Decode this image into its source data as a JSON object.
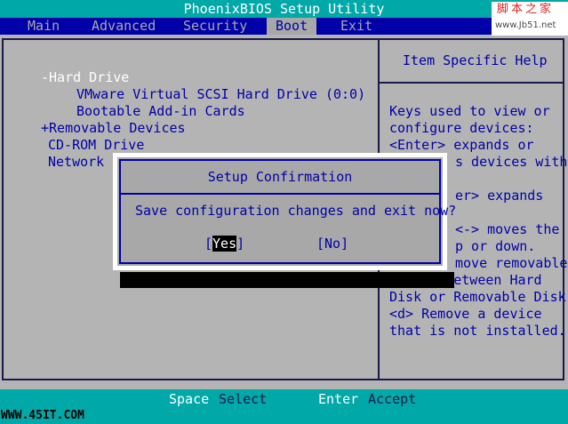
{
  "title": "PhoenixBIOS Setup Utility",
  "menu": {
    "main": "Main",
    "advanced": "Advanced",
    "security": "Security",
    "boot": "Boot",
    "exit": "Exit"
  },
  "watermark": {
    "chinese": "脚本之家",
    "url": "www.Jb51.net"
  },
  "boot_list": {
    "hard_drive": "-Hard Drive",
    "vmware_disk": "VMware Virtual SCSI Hard Drive (0:0)",
    "bootable_cards": "Bootable Add-in Cards",
    "removable": "+Removable Devices",
    "cdrom": "CD-ROM Drive",
    "network": "Network b"
  },
  "help": {
    "title": "Item Specific Help",
    "lines": [
      "Keys used to view or",
      "configure devices:",
      "<Enter> expands or",
      "s devices with",
      "er> expands",
      "<-> moves the",
      "p or down.",
      "move removable",
      "device between Hard",
      "Disk or Removable Disk",
      "<d> Remove a device",
      "that is not installed."
    ]
  },
  "dialog": {
    "title": "Setup Confirmation",
    "message": "Save configuration changes and exit now?",
    "yes_bracket_left": "[",
    "yes_label": "Yes",
    "yes_bracket_right": "]",
    "no_label": "[No]"
  },
  "bottom": {
    "space_key": "Space",
    "space_action": "Select",
    "enter_key": "Enter",
    "enter_action": "Accept",
    "site": "WWW.45IT.COM"
  }
}
